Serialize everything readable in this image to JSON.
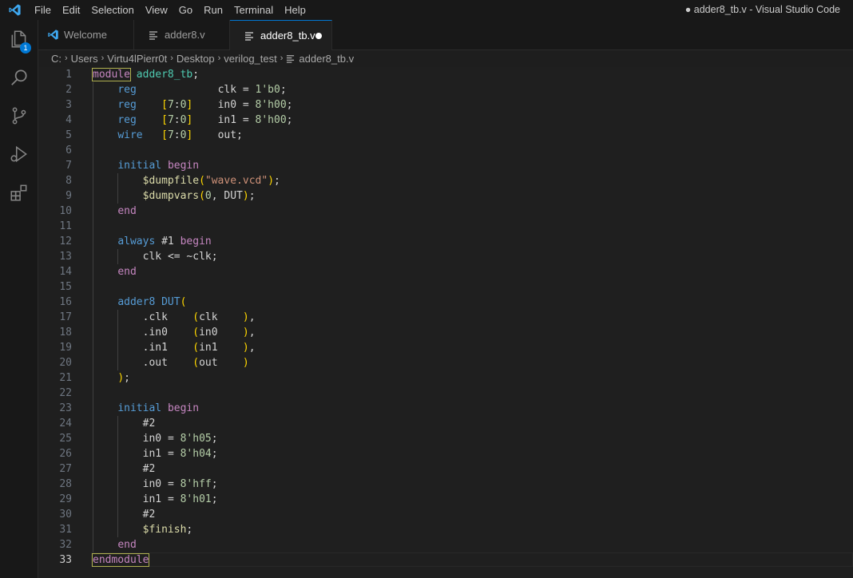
{
  "titlebar": {
    "menu": [
      "File",
      "Edit",
      "Selection",
      "View",
      "Go",
      "Run",
      "Terminal",
      "Help"
    ],
    "window_title": "● adder8_tb.v - Visual Studio Code"
  },
  "activity": {
    "items": [
      "explorer-icon",
      "search-icon",
      "source-control-icon",
      "run-debug-icon",
      "extensions-icon"
    ],
    "explorer_badge": "1"
  },
  "tabs": [
    {
      "label": "Welcome",
      "icon": "vscode-logo-icon"
    },
    {
      "label": "adder8.v",
      "icon": "lines-icon"
    },
    {
      "label": "adder8_tb.v",
      "icon": "lines-icon",
      "modified": true
    }
  ],
  "breadcrumbs": [
    "C:",
    "Users",
    "Virtu4lPierr0t",
    "Desktop",
    "verilog_test",
    "adder8_tb.v"
  ],
  "editor": {
    "current_line": 33,
    "lines": [
      "module adder8_tb;",
      "    reg             clk = 1'b0;",
      "    reg    [7:0]    in0 = 8'h00;",
      "    reg    [7:0]    in1 = 8'h00;",
      "    wire   [7:0]    out;",
      "",
      "    initial begin",
      "        $dumpfile(\"wave.vcd\");",
      "        $dumpvars(0, DUT);",
      "    end",
      "",
      "    always #1 begin",
      "        clk <= ~clk;",
      "    end",
      "",
      "    adder8 DUT(",
      "        .clk    (clk    ),",
      "        .in0    (in0    ),",
      "        .in1    (in1    ),",
      "        .out    (out    )",
      "    );",
      "",
      "    initial begin",
      "        #2",
      "        in0 = 8'h05;",
      "        in1 = 8'h04;",
      "        #2",
      "        in0 = 8'hff;",
      "        in1 = 8'h01;",
      "        #2",
      "        $finish;",
      "    end",
      "endmodule"
    ]
  },
  "colors": {
    "accent": "#0078d4",
    "keyword": "#569cd6",
    "control": "#c586c0",
    "number": "#b5cea8",
    "string": "#ce9178"
  }
}
